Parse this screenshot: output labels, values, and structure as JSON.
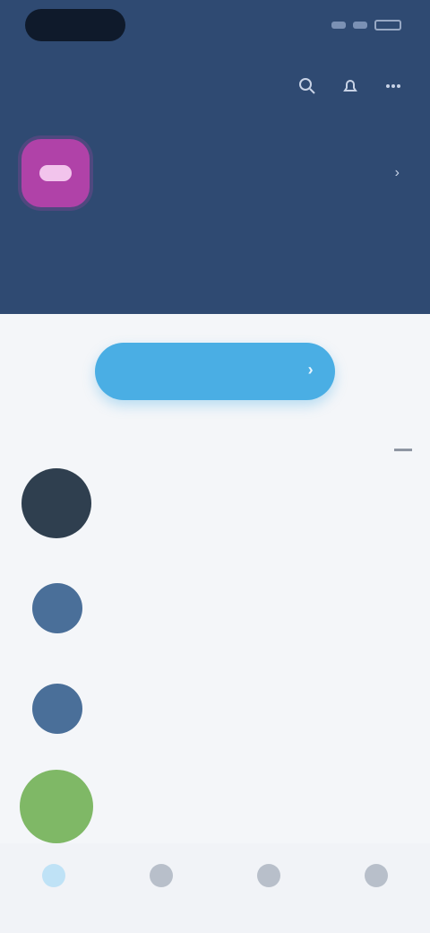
{
  "colors": {
    "header": "#2f4a72",
    "accent": "#4aaee4",
    "avatar_tile": "#b042a8"
  },
  "toolbar": {
    "title": "",
    "icons": [
      "search-icon",
      "bell-icon",
      "more-icon"
    ]
  },
  "profile": {
    "name": "",
    "chevron": "›"
  },
  "stats": [
    {
      "value": "",
      "label": ""
    },
    {
      "value": "",
      "label": ""
    },
    {
      "value": "",
      "label": ""
    }
  ],
  "primary_action": {
    "label": "",
    "arrow": "›"
  },
  "segments": [
    {
      "label": ""
    },
    {
      "label": ""
    },
    {
      "label": "",
      "active": true
    }
  ],
  "items": [
    {
      "name": "",
      "amount": "",
      "sub": "",
      "color": "#2f3f4f"
    },
    {
      "name": "",
      "amount": "",
      "sub": "",
      "color": "#4a6f99"
    },
    {
      "name": "",
      "amount": "",
      "sub": "",
      "color": "#4a6f99"
    },
    {
      "name": "",
      "amount": "",
      "sub": "",
      "color": "#7fb866"
    }
  ],
  "nav": [
    {
      "icon": "home-icon",
      "active": true
    },
    {
      "icon": "chart-icon"
    },
    {
      "icon": "wallet-icon"
    },
    {
      "icon": "profile-icon"
    }
  ]
}
